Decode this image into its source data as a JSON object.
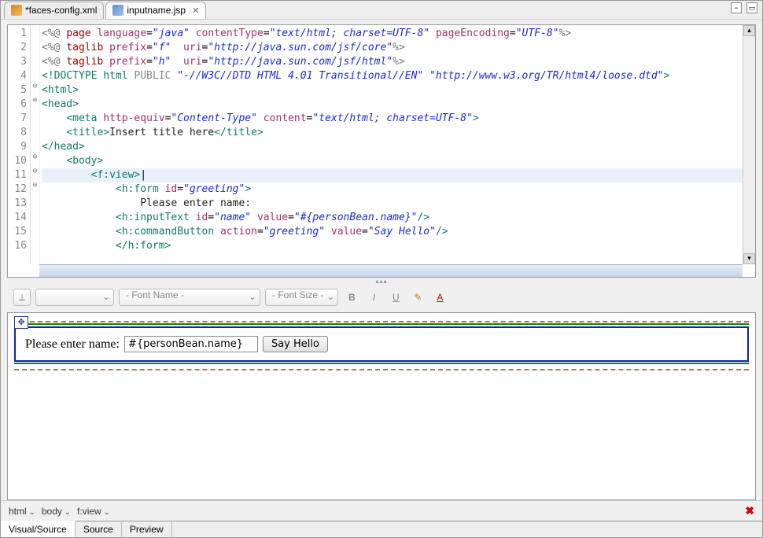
{
  "tabs": [
    {
      "label": "*faces-config.xml",
      "icon": "xml",
      "active": false
    },
    {
      "label": "inputname.jsp",
      "icon": "jsp",
      "active": true,
      "closable": true
    }
  ],
  "code": {
    "lines": [
      {
        "n": 1,
        "fold": "",
        "html": "<span class='t-dir'>&lt;%@</span> <span class='t-kw'>page</span> <span class='t-attr'>language</span>=<span class='t-str'>\"java\"</span> <span class='t-attr'>contentType</span>=<span class='t-str'>\"text/html; charset=UTF-8\"</span> <span class='t-attr'>pageEncoding</span>=<span class='t-str'>\"UTF-8\"</span><span class='t-dir'>%&gt;</span>"
      },
      {
        "n": 2,
        "fold": "",
        "html": "<span class='t-dir'>&lt;%@</span> <span class='t-kw'>taglib</span> <span class='t-attr'>prefix</span>=<span class='t-str'>\"f\"</span>  <span class='t-attr'>uri</span>=<span class='t-str'>\"http://java.sun.com/jsf/core\"</span><span class='t-dir'>%&gt;</span>"
      },
      {
        "n": 3,
        "fold": "",
        "html": "<span class='t-dir'>&lt;%@</span> <span class='t-kw'>taglib</span> <span class='t-attr'>prefix</span>=<span class='t-str'>\"h\"</span>  <span class='t-attr'>uri</span>=<span class='t-str'>\"http://java.sun.com/jsf/html\"</span><span class='t-dir'>%&gt;</span>"
      },
      {
        "n": 4,
        "fold": "",
        "html": "<span class='t-tag'>&lt;!DOCTYPE html </span><span class='t-doct'>PUBLIC</span> <span class='t-str'>\"-//W3C//DTD HTML 4.01 Transitional//EN\" \"http://www.w3.org/TR/html4/loose.dtd\"</span><span class='t-tag'>&gt;</span>"
      },
      {
        "n": 5,
        "fold": "⊖",
        "html": "<span class='t-tag'>&lt;html&gt;</span>"
      },
      {
        "n": 6,
        "fold": "⊖",
        "html": "<span class='t-tag'>&lt;head&gt;</span>"
      },
      {
        "n": 7,
        "fold": "",
        "html": "    <span class='t-tag'>&lt;meta</span> <span class='t-attr'>http-equiv</span>=<span class='t-str'>\"Content-Type\"</span> <span class='t-attr'>content</span>=<span class='t-str'>\"text/html; charset=UTF-8\"</span><span class='t-tag'>&gt;</span>"
      },
      {
        "n": 8,
        "fold": "",
        "html": "    <span class='t-tag'>&lt;title&gt;</span><span class='t-text'>Insert title here</span><span class='t-tag'>&lt;/title&gt;</span>"
      },
      {
        "n": 9,
        "fold": "",
        "html": "<span class='t-tag'>&lt;/head&gt;</span>"
      },
      {
        "n": 10,
        "fold": "⊖",
        "html": "    <span class='t-tag'>&lt;body&gt;</span>"
      },
      {
        "n": 11,
        "fold": "⊖",
        "cur": true,
        "html": "        <span class='t-tag'>&lt;f:view&gt;</span>|"
      },
      {
        "n": 12,
        "fold": "⊖",
        "html": "            <span class='t-tag'>&lt;h:form</span> <span class='t-attr'>id</span>=<span class='t-str'>\"greeting\"</span><span class='t-tag'>&gt;</span>"
      },
      {
        "n": 13,
        "fold": "",
        "html": "                <span class='t-text'>Please enter name:</span>"
      },
      {
        "n": 14,
        "fold": "",
        "html": "            <span class='t-tag'>&lt;h:inputText</span> <span class='t-attr'>id</span>=<span class='t-str'>\"name\"</span> <span class='t-attr'>value</span>=<span class='t-str'>\"#{personBean.name}\"</span><span class='t-tag'>/&gt;</span>"
      },
      {
        "n": 15,
        "fold": "",
        "html": "            <span class='t-tag'>&lt;h:commandButton</span> <span class='t-attr'>action</span>=<span class='t-str'>\"greeting\"</span> <span class='t-attr'>value</span>=<span class='t-str'>\"Say Hello\"</span><span class='t-tag'>/&gt;</span>"
      },
      {
        "n": 16,
        "fold": "",
        "html": "            <span class='t-tag'>&lt;/h:form&gt;</span>"
      }
    ]
  },
  "toolbar": {
    "style_combo": "",
    "font_name": "- Font Name -",
    "font_size": "- Font Size -"
  },
  "preview": {
    "label": "Please enter name:",
    "input_value": "#{personBean.name}",
    "button_label": "Say Hello"
  },
  "breadcrumb": [
    "html",
    "body",
    "f:view"
  ],
  "bottom_tabs": {
    "items": [
      "Visual/Source",
      "Source",
      "Preview"
    ],
    "active": 0
  }
}
